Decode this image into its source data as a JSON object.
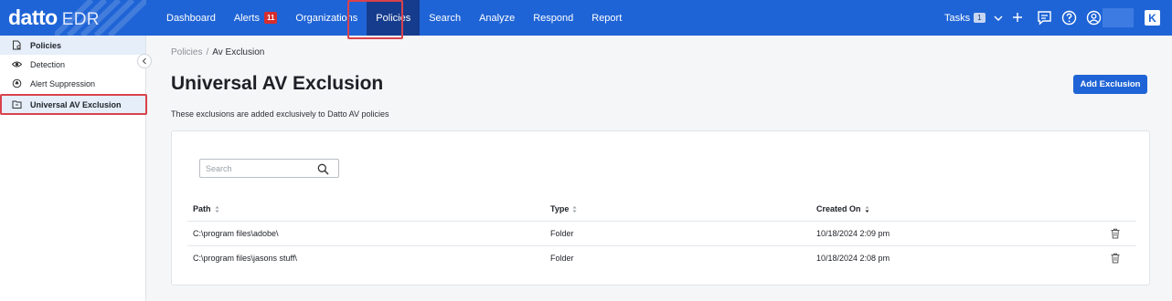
{
  "brand": {
    "logo": "datto",
    "product": "EDR"
  },
  "nav": {
    "items": [
      {
        "label": "Dashboard"
      },
      {
        "label": "Alerts",
        "badge": "11"
      },
      {
        "label": "Organizations"
      },
      {
        "label": "Policies",
        "active": true
      },
      {
        "label": "Search"
      },
      {
        "label": "Analyze"
      },
      {
        "label": "Respond"
      },
      {
        "label": "Report"
      }
    ],
    "tasks": {
      "label": "Tasks",
      "count": "1"
    },
    "icons": [
      "add-icon",
      "chat-icon",
      "help-icon",
      "user-icon",
      "kaseya-icon"
    ]
  },
  "sidebar": {
    "items": [
      {
        "label": "Policies",
        "icon": "policy-icon"
      },
      {
        "label": "Detection",
        "icon": "eye-icon"
      },
      {
        "label": "Alert Suppression",
        "icon": "suppression-icon"
      },
      {
        "label": "Universal AV Exclusion",
        "icon": "folder-icon",
        "selected": true
      }
    ]
  },
  "breadcrumb": {
    "parent": "Policies",
    "separator": "/",
    "current": "Av Exclusion"
  },
  "page": {
    "title": "Universal AV Exclusion",
    "subtitle": "These exclusions are added exclusively to Datto AV policies",
    "add_button": "Add Exclusion"
  },
  "search": {
    "placeholder": "Search",
    "value": ""
  },
  "table": {
    "columns": [
      "Path",
      "Type",
      "Created On"
    ],
    "rows": [
      {
        "path": "C:\\program files\\adobe\\",
        "type": "Folder",
        "created": "10/18/2024 2:09 pm"
      },
      {
        "path": "C:\\program files\\jasons stuff\\",
        "type": "Folder",
        "created": "10/18/2024 2:08 pm"
      }
    ]
  },
  "colors": {
    "primary": "#1f64d6",
    "nav_active": "#163c8d",
    "badge": "#d62d2d",
    "highlight": "#d9424b",
    "selected_bg": "#e5eef9"
  }
}
